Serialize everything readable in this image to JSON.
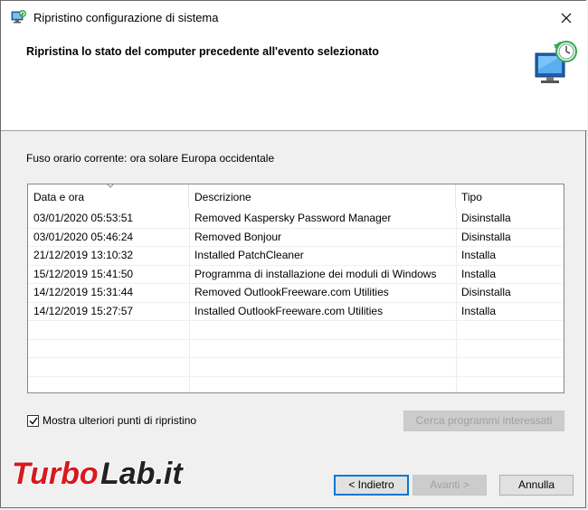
{
  "window": {
    "title": "Ripristino configurazione di sistema",
    "close_glyph": "✕"
  },
  "header": {
    "title": "Ripristina lo stato del computer precedente all'evento selezionato"
  },
  "timezone": {
    "label": "Fuso orario corrente: ora solare Europa occidentale"
  },
  "list": {
    "columns": [
      "Data e ora",
      "Descrizione",
      "Tipo"
    ],
    "rows": [
      {
        "date": "03/01/2020 05:53:51",
        "description": "Removed Kaspersky Password Manager",
        "type": "Disinstalla"
      },
      {
        "date": "03/01/2020 05:46:24",
        "description": "Removed Bonjour",
        "type": "Disinstalla"
      },
      {
        "date": "21/12/2019 13:10:32",
        "description": "Installed PatchCleaner",
        "type": "Installa"
      },
      {
        "date": "15/12/2019 15:41:50",
        "description": "Programma di installazione dei moduli di Windows",
        "type": "Installa"
      },
      {
        "date": "14/12/2019 15:31:44",
        "description": "Removed OutlookFreeware.com Utilities",
        "type": "Disinstalla"
      },
      {
        "date": "14/12/2019 15:27:57",
        "description": "Installed OutlookFreeware.com Utilities",
        "type": "Installa"
      }
    ]
  },
  "options": {
    "show_more_label": "Mostra ulteriori punti di ripristino",
    "show_more_checked": true
  },
  "buttons": {
    "search_label": "Cerca programmi interessati",
    "back_label": "< Indietro",
    "next_label": "Avanti >",
    "cancel_label": "Annulla"
  },
  "watermark": {
    "text_red": "Turbo",
    "text_dark": "Lab.it"
  },
  "colors": {
    "accent": "#0078d7",
    "watermark_red": "#d71920",
    "watermark_dark": "#222222"
  }
}
